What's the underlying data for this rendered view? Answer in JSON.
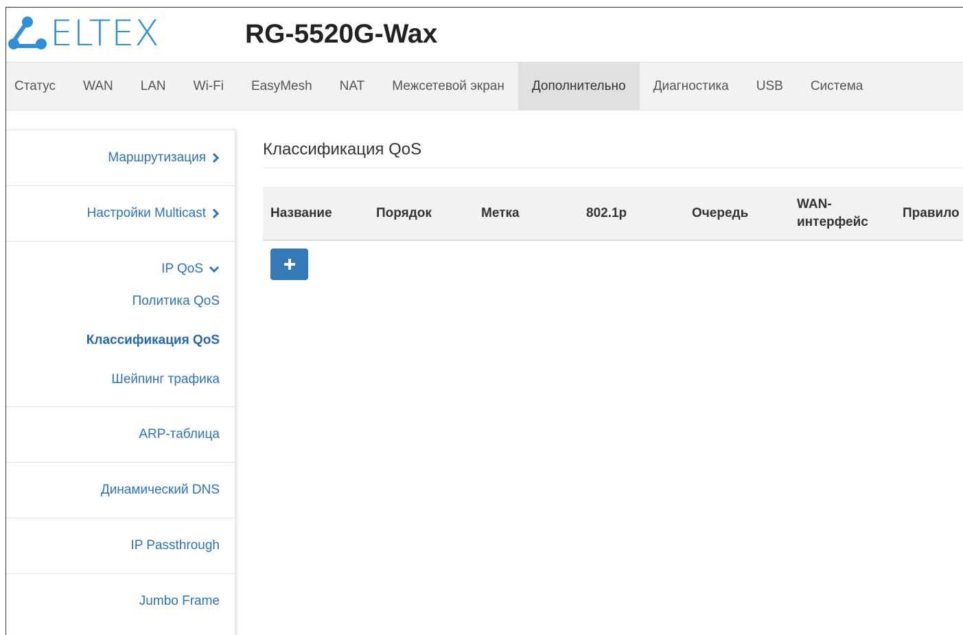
{
  "brand": {
    "logo_text": "ELTEX",
    "model": "RG-5520G-Wax",
    "accent": "#2f8fd6"
  },
  "nav": {
    "items": [
      "Статус",
      "WAN",
      "LAN",
      "Wi-Fi",
      "EasyMesh",
      "NAT",
      "Межсетевой экран",
      "Дополнительно",
      "Диагностика",
      "USB",
      "Система"
    ],
    "active": "Дополнительно"
  },
  "sidebar": {
    "routing": "Маршрутизация",
    "multicast": "Настройки Multicast",
    "ipqos": "IP QoS",
    "qos_policy": "Политика QoS",
    "qos_class": "Классификация QoS",
    "shaping": "Шейпинг трафика",
    "arp": "ARP-таблица",
    "ddns": "Динамический DNS",
    "passthrough": "IP Passthrough",
    "jumbo": "Jumbo Frame"
  },
  "main": {
    "title": "Классификация QoS",
    "columns": [
      "Название",
      "Порядок",
      "Метка",
      "802.1p",
      "Очередь",
      "WAN-\nинтерфейс",
      "Правило"
    ],
    "add_label": "+"
  }
}
